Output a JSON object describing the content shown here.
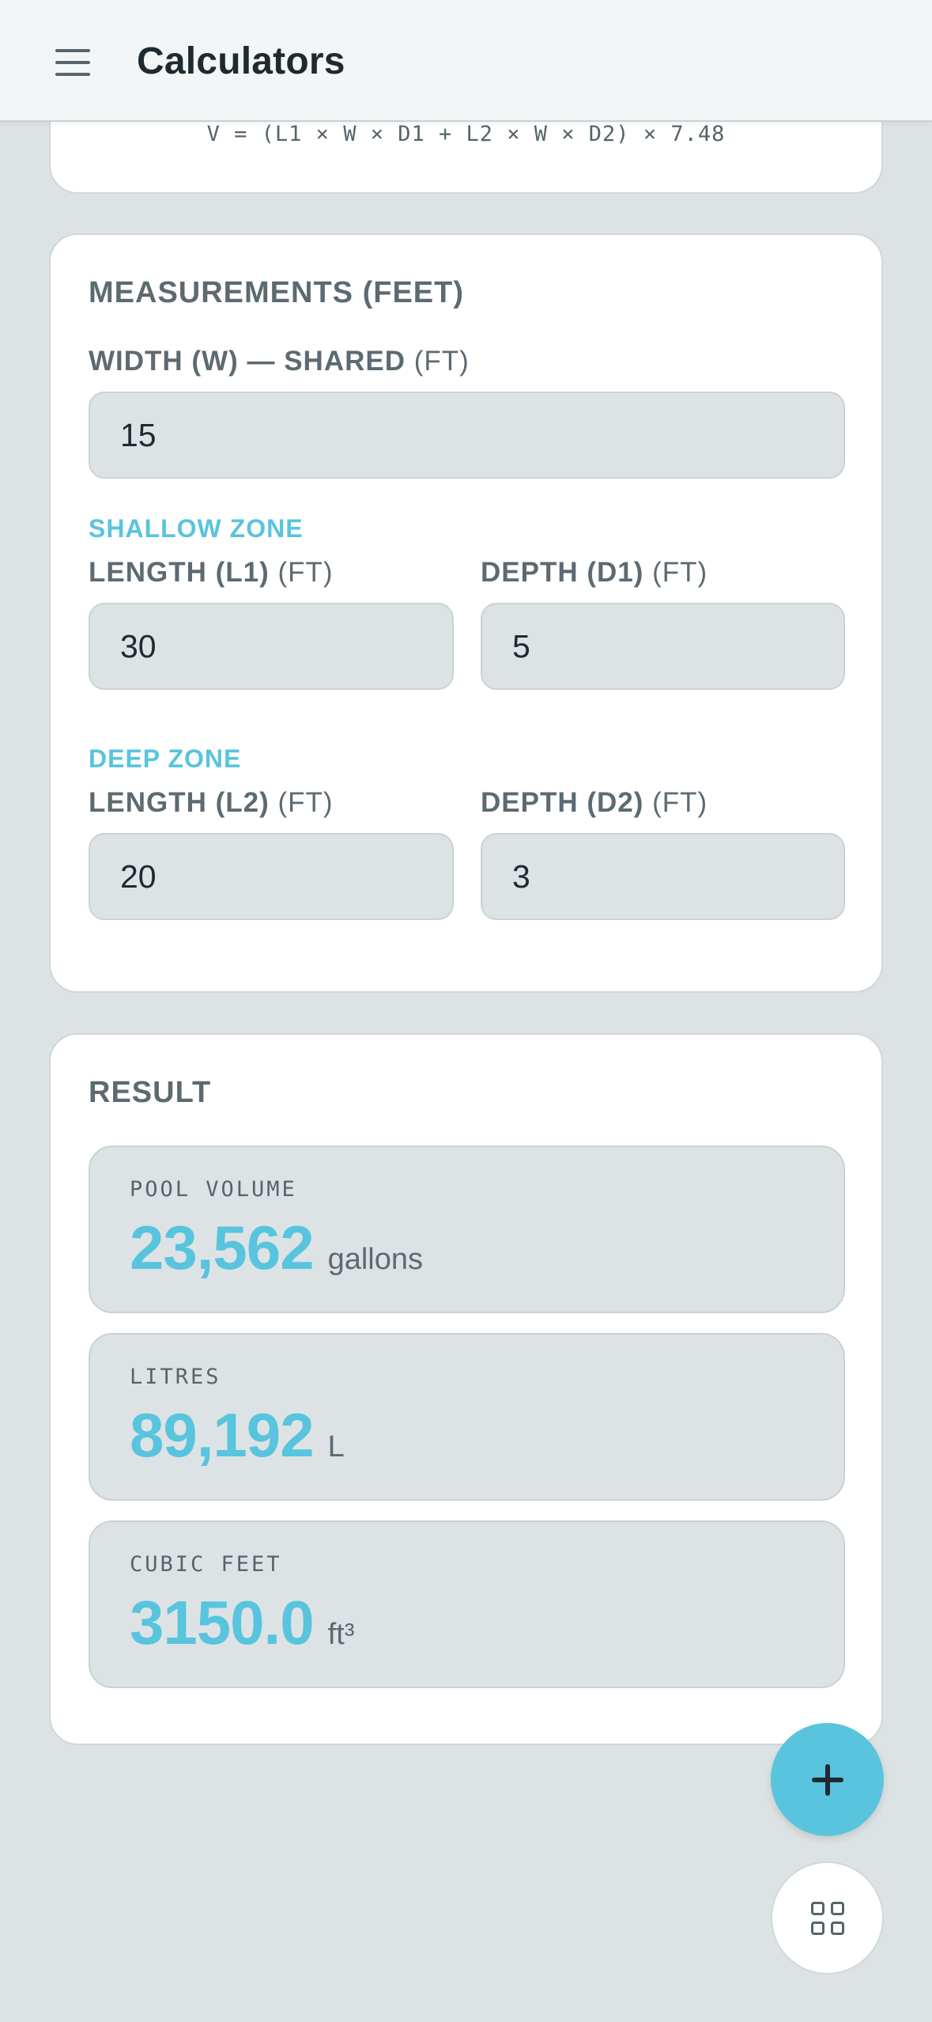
{
  "header": {
    "title": "Calculators",
    "menu_icon": "hamburger-menu-icon"
  },
  "formula": {
    "text": "V = (L1 × W × D1 + L2 × W × D2) × 7.48"
  },
  "measurements": {
    "title": "MEASUREMENTS (FEET)",
    "width": {
      "label": "WIDTH (W) — SHARED",
      "unit": "(FT)",
      "value": "15"
    },
    "shallow": {
      "title": "SHALLOW ZONE",
      "length": {
        "label": "LENGTH (L1)",
        "unit": "(FT)",
        "value": "30"
      },
      "depth": {
        "label": "DEPTH (D1)",
        "unit": "(FT)",
        "value": "5"
      }
    },
    "deep": {
      "title": "DEEP ZONE",
      "length": {
        "label": "LENGTH (L2)",
        "unit": "(FT)",
        "value": "20"
      },
      "depth": {
        "label": "DEPTH (D2)",
        "unit": "(FT)",
        "value": "3"
      }
    }
  },
  "result": {
    "title": "RESULT",
    "items": [
      {
        "label": "POOL VOLUME",
        "value": "23,562",
        "unit": "gallons"
      },
      {
        "label": "LITRES",
        "value": "89,192",
        "unit": "L"
      },
      {
        "label": "CUBIC FEET",
        "value": "3150.0",
        "unit": "ft³"
      }
    ]
  },
  "fabs": {
    "add_icon": "plus-icon",
    "grid_icon": "grid-icon"
  },
  "colors": {
    "accent": "#58c4dd",
    "background": "#dde3e5",
    "card": "#ffffff",
    "text_muted": "#5c6a72"
  }
}
